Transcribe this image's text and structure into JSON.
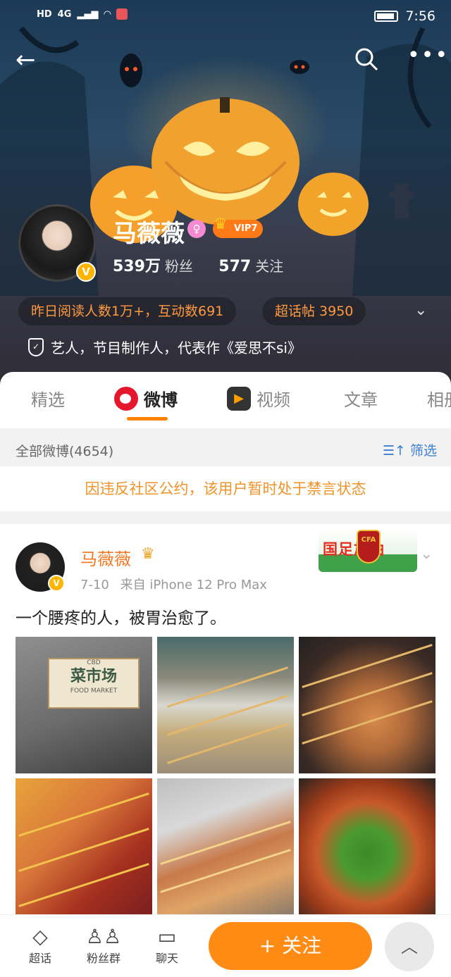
{
  "status_bar": {
    "left": [
      "HD",
      "4G"
    ],
    "time": "7:56"
  },
  "profile": {
    "name": "马薇薇",
    "vip": "VIP7",
    "fans_count": "539万",
    "fans_label": "粉丝",
    "following_count": "577",
    "following_label": "关注",
    "stats_pill": "昨日阅读人数1万+，互动数691",
    "topic_pill": "超话帖 3950",
    "verification": "艺人，节目制作人，代表作《爱思不si》",
    "verified_badge": "V",
    "gender_icon": "female-icon"
  },
  "tabs": [
    {
      "label": "精选"
    },
    {
      "label": "微博"
    },
    {
      "label": "视频"
    },
    {
      "label": "文章"
    },
    {
      "label": "相册"
    }
  ],
  "filter": {
    "count_label": "全部微博(4654)",
    "filter_label": "筛选"
  },
  "notice": "因违反社区公约，该用户暂时处于禁言状态",
  "post": {
    "author": "马薇薇",
    "date": "7-10",
    "source": "来自 iPhone 12 Pro Max",
    "text": "一个腰疼的人，被胃治愈了。",
    "sticker_text": "国足加油",
    "sticker_badge": "CFA",
    "sign_title": "菜市场",
    "sign_top": "CBD",
    "sign_bottom": "FOOD MARKET"
  },
  "bottom_bar": {
    "items": [
      {
        "label": "超话",
        "icon": "diamond-icon"
      },
      {
        "label": "粉丝群",
        "icon": "group-icon"
      },
      {
        "label": "聊天",
        "icon": "chat-icon"
      }
    ],
    "follow": "+ 关注",
    "up": "^"
  },
  "colors": {
    "accent": "#ff8a14",
    "link": "#3d7fd3",
    "notice": "#f09328",
    "name_orange": "#f57a24"
  }
}
